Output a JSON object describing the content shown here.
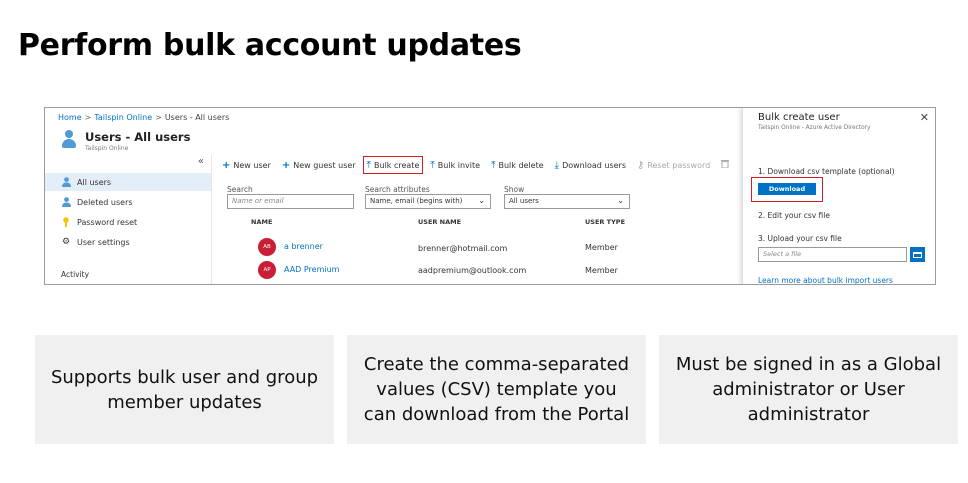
{
  "slide": {
    "title": "Perform bulk account updates"
  },
  "portal": {
    "breadcrumb": [
      "Home",
      "Tailspin Online",
      "Users - All users"
    ],
    "page_title": "Users - All users",
    "page_subtitle": "Tailspin Online",
    "collapse_glyph": "«",
    "sidebar": {
      "items": [
        {
          "label": "All users",
          "icon": "user-icon",
          "active": true
        },
        {
          "label": "Deleted users",
          "icon": "deleted-user-icon",
          "active": false
        },
        {
          "label": "Password reset",
          "icon": "key-icon",
          "active": false
        },
        {
          "label": "User settings",
          "icon": "gear-icon",
          "active": false
        }
      ],
      "section_label": "Activity"
    },
    "toolbar": [
      {
        "label": "New user",
        "icon": "plus-icon"
      },
      {
        "label": "New guest user",
        "icon": "plus-icon"
      },
      {
        "label": "Bulk create",
        "icon": "upload-icon",
        "highlighted": true
      },
      {
        "label": "Bulk invite",
        "icon": "upload-icon"
      },
      {
        "label": "Bulk delete",
        "icon": "upload-icon"
      },
      {
        "label": "Download users",
        "icon": "download-icon"
      },
      {
        "label": "Reset password",
        "icon": "key-icon",
        "disabled": true
      },
      {
        "label": "",
        "icon": "trash-icon",
        "disabled": true
      }
    ],
    "filters": {
      "search_label": "Search",
      "search_placeholder": "Name or email",
      "attributes_label": "Search attributes",
      "attributes_value": "Name, email (begins with)",
      "show_label": "Show",
      "show_value": "All users"
    },
    "table": {
      "columns": [
        "NAME",
        "USER NAME",
        "USER TYPE"
      ],
      "rows": [
        {
          "initials": "AB",
          "name": "a brenner",
          "username": "brenner@hotmail.com",
          "type": "Member"
        },
        {
          "initials": "AP",
          "name": "AAD Premium",
          "username": "aadpremium@outlook.com",
          "type": "Member"
        }
      ]
    },
    "blade": {
      "title": "Bulk create user",
      "subtitle": "Tailspin Online - Azure Active Directory",
      "close_glyph": "✕",
      "step1": "1. Download csv template (optional)",
      "download_label": "Download",
      "step2": "2. Edit your csv file",
      "step3": "3. Upload your csv file",
      "file_placeholder": "Select a file",
      "link": "Learn more about bulk import users"
    }
  },
  "cards": [
    {
      "lines": [
        "Supports bulk user and group",
        "member updates"
      ]
    },
    {
      "lines": [
        "Create the comma-separated",
        "values (CSV) template you",
        "can download from the Portal"
      ]
    },
    {
      "lines": [
        "Must be signed in as a Global",
        "administrator or User",
        "administrator"
      ]
    }
  ],
  "colors": {
    "accent": "#0072c6",
    "highlight": "#d21f26",
    "avatar": "#c81e36",
    "card_bg": "#f0f0f0"
  }
}
